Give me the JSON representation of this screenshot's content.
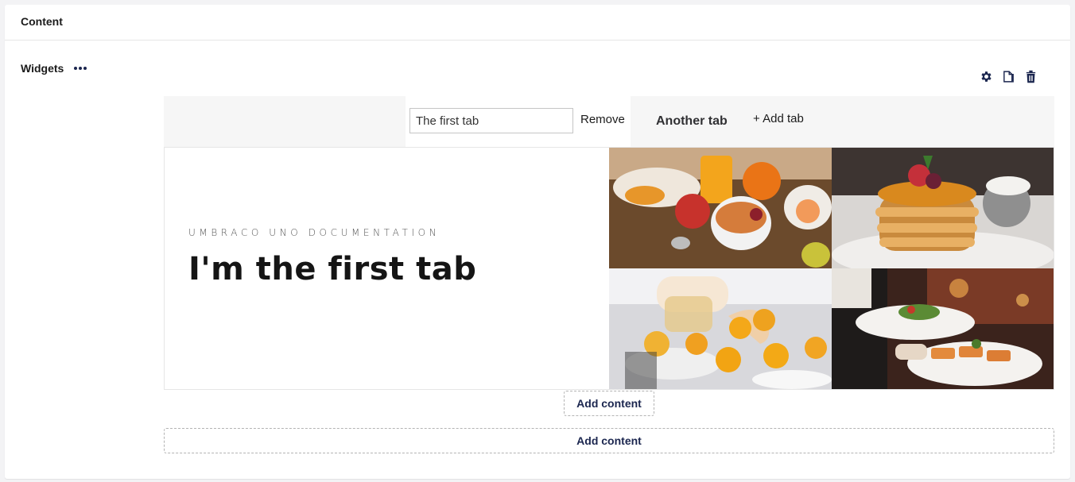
{
  "panel": {
    "title": "Content"
  },
  "property": {
    "label": "Widgets",
    "more_icon": "ellipsis-icon"
  },
  "block_actions": [
    {
      "name": "settings",
      "icon": "gear-icon"
    },
    {
      "name": "copy",
      "icon": "copy-icon"
    },
    {
      "name": "delete",
      "icon": "trash-icon"
    }
  ],
  "tabs": {
    "active_tab_value": "The first tab",
    "remove_label": "Remove",
    "other_tab_label": "Another tab",
    "add_tab_label": "+ Add tab"
  },
  "content": {
    "eyebrow": "UMBRACO UNO DOCUMENTATION",
    "headline": "I'm the first tab",
    "gallery": [
      {
        "alt": "breakfast-table-photo"
      },
      {
        "alt": "pancake-stack-photo"
      },
      {
        "alt": "chef-plating-photo"
      },
      {
        "alt": "waiter-serving-photo"
      }
    ]
  },
  "add_content_inline_label": "Add content",
  "add_content_block_label": "Add content"
}
